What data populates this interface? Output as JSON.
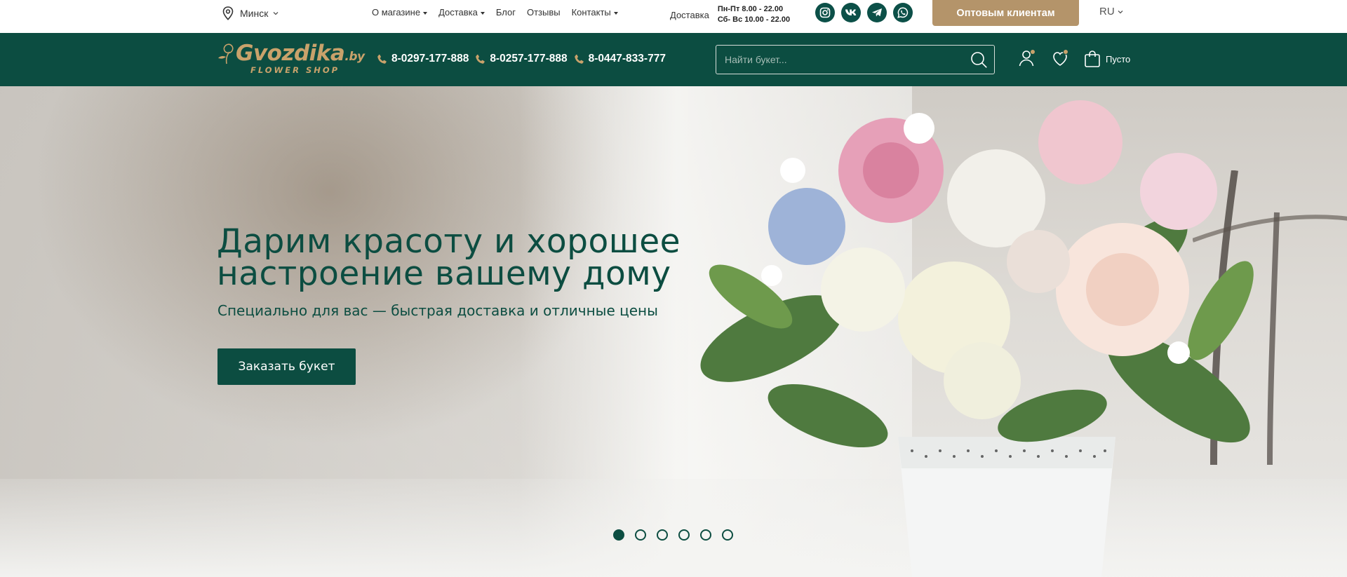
{
  "topbar": {
    "city": "Минск",
    "nav": [
      {
        "label": "О магазине",
        "dropdown": true
      },
      {
        "label": "Доставка",
        "dropdown": true
      },
      {
        "label": "Блог",
        "dropdown": false
      },
      {
        "label": "Отзывы",
        "dropdown": false
      },
      {
        "label": "Контакты",
        "dropdown": true
      }
    ],
    "delivery_label": "Доставка",
    "hours": [
      "Пн-Пт 8.00 - 22.00",
      "Сб- Вс 10.00 - 22.00"
    ],
    "socials": [
      "instagram-icon",
      "vk-icon",
      "telegram-icon",
      "whatsapp-icon"
    ],
    "wholesale_label": "Оптовым клиентам",
    "language": "RU"
  },
  "header": {
    "logo_main": "Gvozdika",
    "logo_domain": ".by",
    "logo_tagline": "FLOWER SHOP",
    "phones": [
      "8-0297-177-888",
      "8-0257-177-888",
      "8-0447-833-777"
    ],
    "search_placeholder": "Найти букет...",
    "cart_label": "Пусто"
  },
  "hero": {
    "title_line1": "Дарим красоту и хорошее",
    "title_line2": "настроение вашему дому",
    "subtitle": "Специально для вас — быстрая доставка и отличные цены",
    "cta": "Заказать букет",
    "slides_total": 6,
    "active_slide": 1
  },
  "colors": {
    "brand_green": "#0c4d41",
    "accent_gold": "#b4946a",
    "logo_gold": "#c9a26b"
  }
}
